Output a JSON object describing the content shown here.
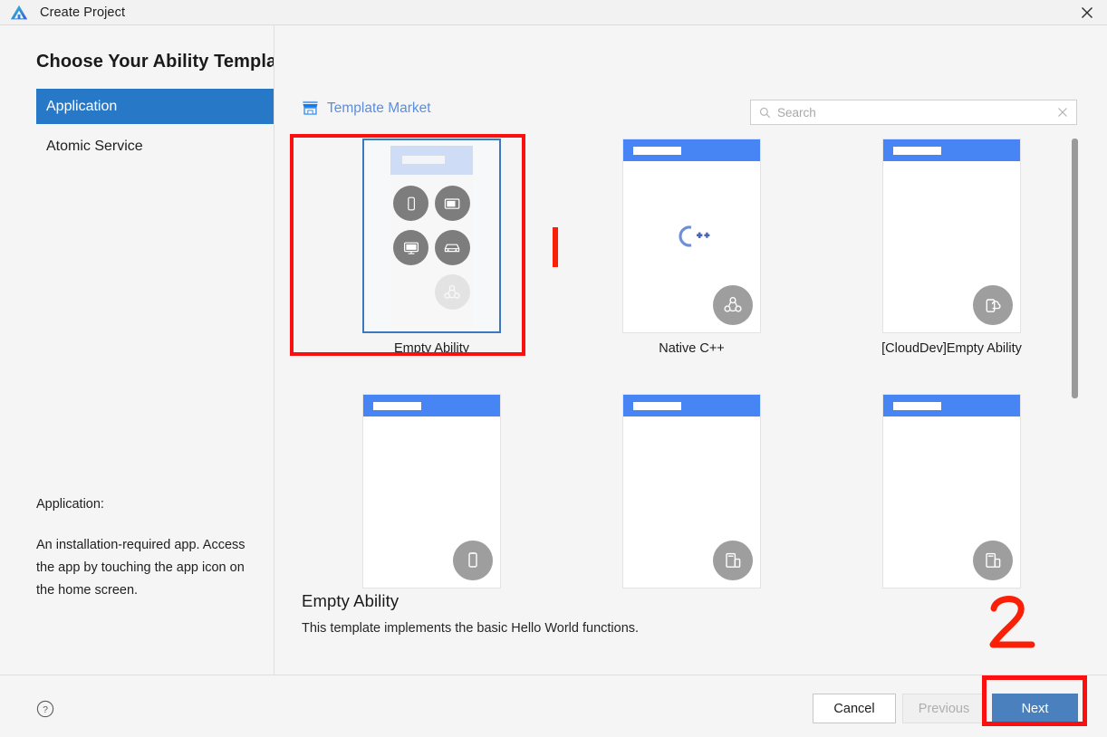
{
  "window": {
    "title": "Create Project",
    "logo_icon": "deveco-logo-icon",
    "close_icon": "close-icon"
  },
  "page": {
    "title": "Choose Your Ability Template"
  },
  "sidebar": {
    "items": [
      {
        "label": "Application",
        "selected": true
      },
      {
        "label": "Atomic Service",
        "selected": false
      }
    ],
    "description": {
      "title": "Application:",
      "body": "An installation-required app. Access the app by touching the app icon on the home screen."
    }
  },
  "toolbar": {
    "market_label": "Template Market",
    "market_icon": "storefront-icon",
    "search": {
      "placeholder": "Search",
      "value": "",
      "search_icon": "search-icon",
      "clear_icon": "close-icon"
    }
  },
  "templates": [
    {
      "label": "Empty Ability",
      "selected": true,
      "style": "device-grid",
      "badge_icon": "",
      "devices": [
        "phone-icon",
        "tablet-icon",
        "tv-icon",
        "car-icon",
        "wearable-icon"
      ]
    },
    {
      "label": "Native C++",
      "selected": false,
      "style": "cpp",
      "badge_icon": "multi-device-icon",
      "center_mark": "C++"
    },
    {
      "label": "[CloudDev]Empty Ability",
      "selected": false,
      "style": "plain",
      "badge_icon": "cloud-phone-icon"
    },
    {
      "label": "",
      "selected": false,
      "style": "plain",
      "badge_icon": "phone-icon"
    },
    {
      "label": "",
      "selected": false,
      "style": "plain",
      "badge_icon": "tablet-phone-icon"
    },
    {
      "label": "",
      "selected": false,
      "style": "plain",
      "badge_icon": "tablet-phone-icon"
    }
  ],
  "detail": {
    "title": "Empty Ability",
    "description": "This template implements the basic Hello World functions."
  },
  "footer": {
    "help_icon": "help-icon",
    "cancel_label": "Cancel",
    "previous_label": "Previous",
    "next_label": "Next"
  },
  "annotations": {
    "step_one": "1",
    "step_two": "2",
    "color": "#fb0f0f"
  },
  "colors": {
    "accent": "#2878c8",
    "card_header": "#4785f4",
    "primary_button": "#4a80bd",
    "link": "#5a8ede",
    "annotation_red": "#fb0f0f"
  }
}
